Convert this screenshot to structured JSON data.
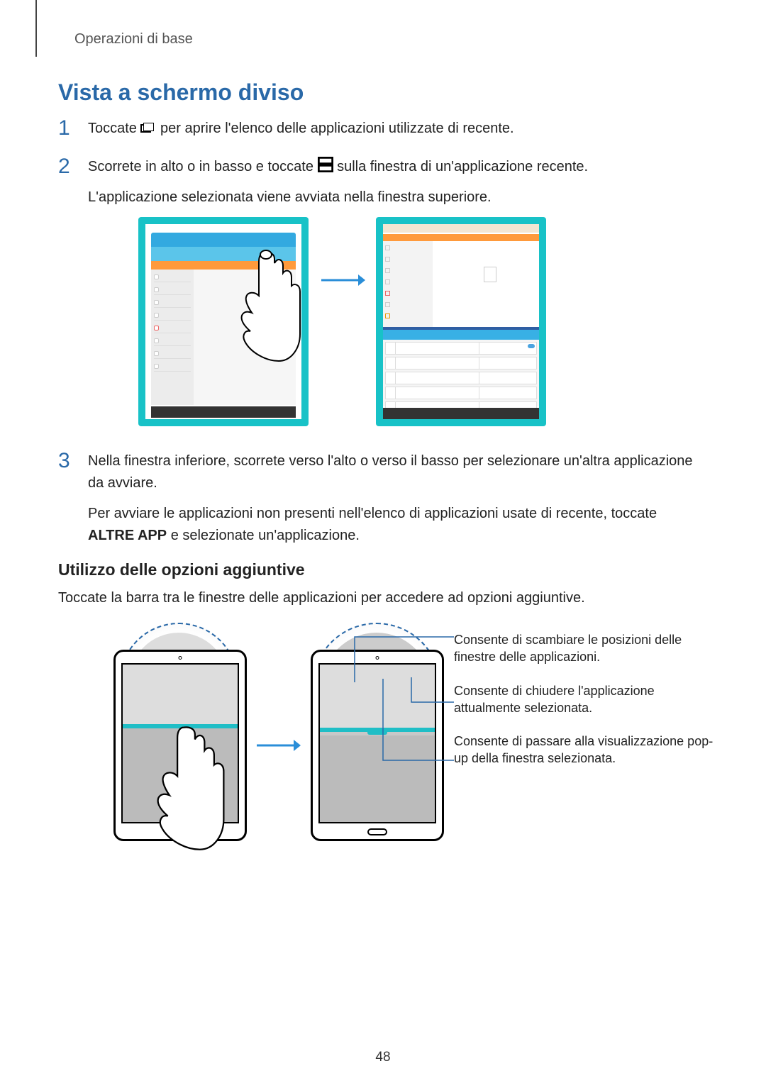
{
  "breadcrumb": "Operazioni di base",
  "h1": "Vista a schermo diviso",
  "steps": {
    "s1": {
      "num": "1",
      "pre": "Toccate ",
      "post": " per aprire l'elenco delle applicazioni utilizzate di recente."
    },
    "s2": {
      "num": "2",
      "line1pre": "Scorrete in alto o in basso e toccate ",
      "line1post": " sulla finestra di un'applicazione recente.",
      "line2": "L'applicazione selezionata viene avviata nella finestra superiore."
    },
    "s3": {
      "num": "3",
      "line1": "Nella finestra inferiore, scorrete verso l'alto o verso il basso per selezionare un'altra applicazione da avviare.",
      "line2pre": "Per avviare le applicazioni non presenti nell'elenco di applicazioni usate di recente, toccate ",
      "line2bold": "ALTRE APP",
      "line2post": " e selezionate un'applicazione."
    }
  },
  "h2": "Utilizzo delle opzioni aggiuntive",
  "h2sub": "Toccate la barra tra le finestre delle applicazioni per accedere ad opzioni aggiuntive.",
  "callouts": {
    "c1": "Consente di scambiare le posizioni delle finestre delle applicazioni.",
    "c2": "Consente di chiudere l'applicazione attualmente selezionata.",
    "c3": "Consente di passare alla visualizzazione pop-up della finestra selezionata."
  },
  "page_num": "48"
}
